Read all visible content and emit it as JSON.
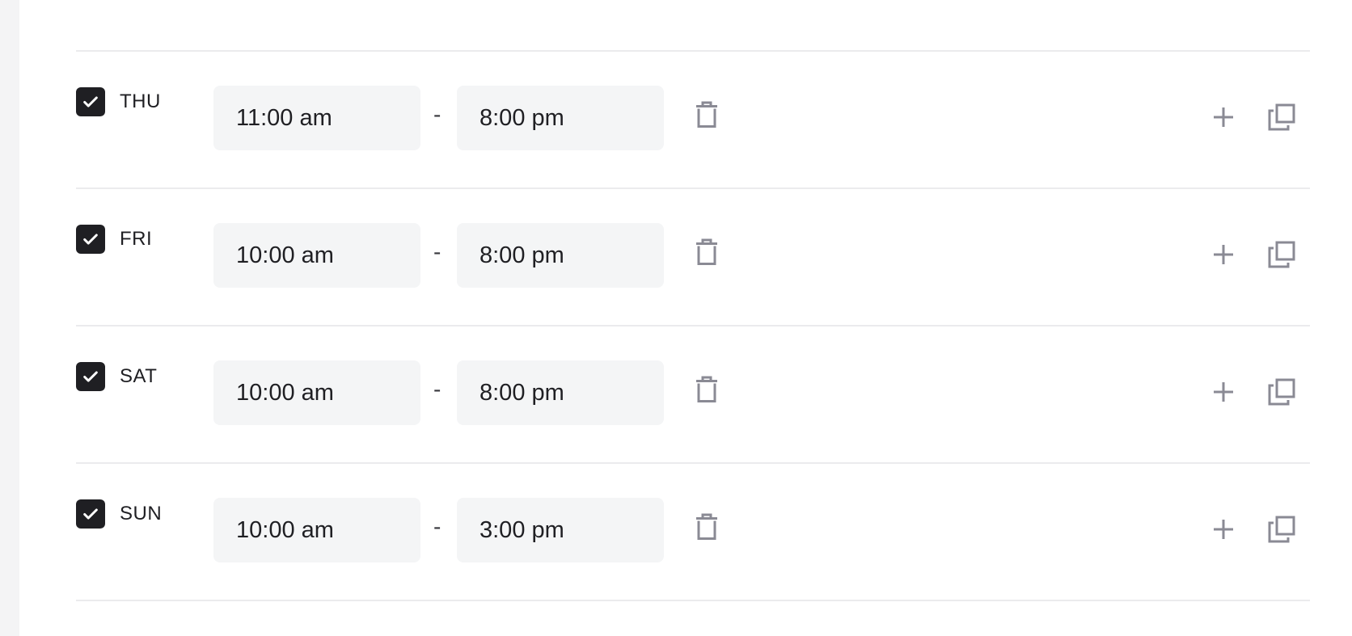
{
  "schedule": {
    "separator": "-",
    "rows": [
      {
        "day": "THU",
        "checked": true,
        "start": "11:00 am",
        "end": "8:00 pm"
      },
      {
        "day": "FRI",
        "checked": true,
        "start": "10:00 am",
        "end": "8:00 pm"
      },
      {
        "day": "SAT",
        "checked": true,
        "start": "10:00 am",
        "end": "8:00 pm"
      },
      {
        "day": "SUN",
        "checked": true,
        "start": "10:00 am",
        "end": "3:00 pm"
      }
    ]
  },
  "icons": {
    "checkbox": "check-icon",
    "delete": "trash-icon",
    "add": "plus-icon",
    "copy": "copy-icon"
  },
  "colors": {
    "checkbox": "#1f1f23",
    "icon": "#8a8a94",
    "field_bg": "#f4f5f6",
    "divider": "#ebebed"
  }
}
